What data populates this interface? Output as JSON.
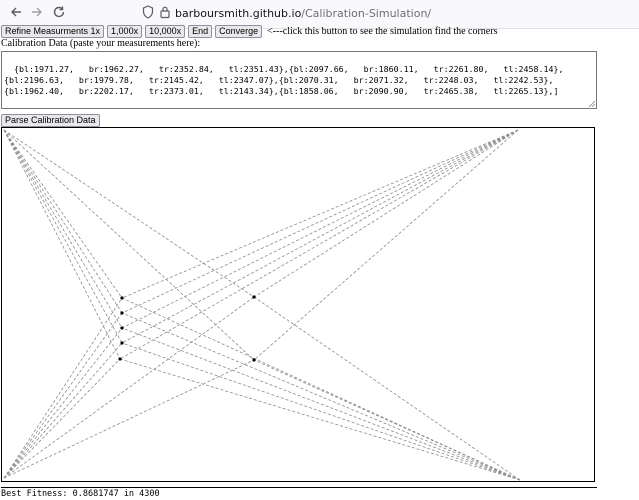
{
  "browser": {
    "url_host": "barboursmith.github.io",
    "url_path": "/Calibration-Simulation/",
    "back_icon": "arrow-left",
    "forward_icon": "arrow-right",
    "reload_icon": "reload",
    "shield_icon": "shield",
    "lock_icon": "lock"
  },
  "toolbar": {
    "refine_label": "Refine Measurments 1x",
    "x1000_label": "1,000x",
    "x10000_label": "10,000x",
    "end_label": "End",
    "converge_label": "Converge",
    "hint": "<---click this button to see the simulation find the corners"
  },
  "calibration": {
    "label": "Calibration Data (paste your measurements here):",
    "value": "{bl:1971.27,   br:1962.27,   tr:2352.84,   tl:2351.43},{bl:2097.66,   br:1860.11,   tr:2261.80,   tl:2458.14},{bl:2196.63,   br:1979.78,   tr:2145.42,   tl:2347.07},{bl:2070.31,   br:2071.32,   tr:2248.03,   tl:2242.53},{bl:1962.40,   br:2202.17,   tr:2373.01,   tl:2143.34},{bl:1858.06,   br:2090.90,   tr:2465.38,   tl:2265.13},]"
  },
  "parse_label": "Parse Calibration Data",
  "status": {
    "text": "Best Fitness: 0.8681747 in 4300"
  },
  "colors": {
    "line": "#8c8c8c",
    "point": "#000000"
  }
}
